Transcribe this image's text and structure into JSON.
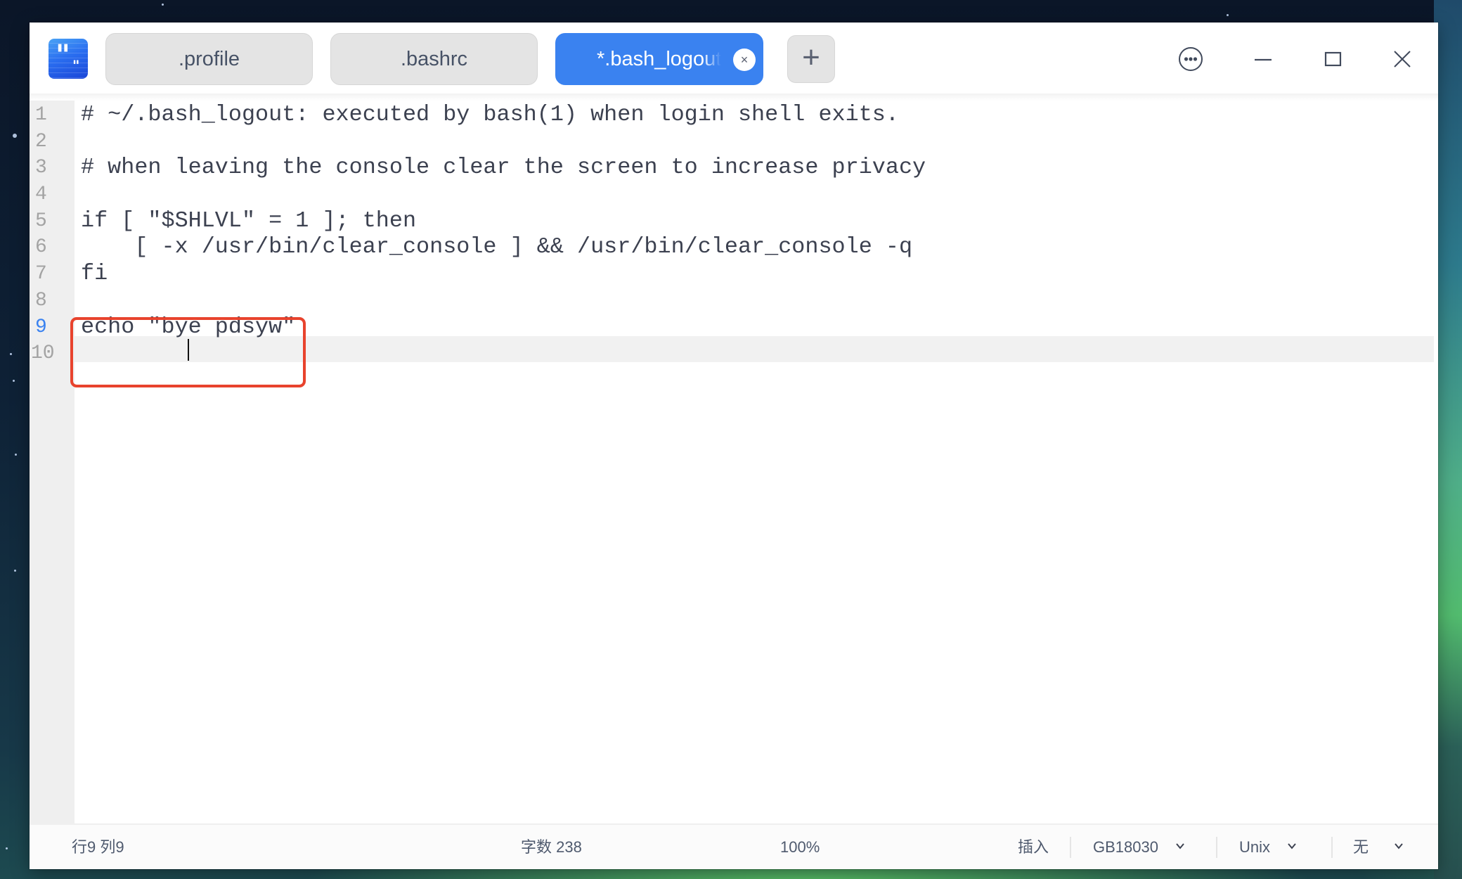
{
  "window": {
    "app_icon": "text-editor-icon",
    "tabs": [
      {
        "label": ".profile",
        "active": false
      },
      {
        "label": ".bashrc",
        "active": false
      },
      {
        "label": "*.bash_logout",
        "active": true,
        "close_icon": "×"
      }
    ],
    "add_tab_label": "+",
    "controls": {
      "menu": "more-options-icon",
      "minimize": "minimize-icon",
      "maximize": "maximize-icon",
      "close": "close-icon"
    }
  },
  "editor": {
    "current_line": 9,
    "line_numbers": [
      "1",
      "2",
      "3",
      "4",
      "5",
      "6",
      "7",
      "8",
      "9",
      "10"
    ],
    "lines": [
      "# ~/.bash_logout: executed by bash(1) when login shell exits.",
      "",
      "# when leaving the console clear the screen to increase privacy",
      "",
      "if [ \"$SHLVL\" = 1 ]; then",
      "    [ -x /usr/bin/clear_console ] && /usr/bin/clear_console -q",
      "fi",
      "",
      "echo \"bye pdsyw\"",
      ""
    ],
    "annotation_color": "#e8432d"
  },
  "statusbar": {
    "position": "行9 列9",
    "char_count": "字数 238",
    "zoom": "100%",
    "mode": "插入",
    "encoding": "GB18030",
    "line_ending": "Unix",
    "highlight": "无"
  },
  "colors": {
    "accent": "#3a82f0",
    "annotation": "#e8432d"
  }
}
